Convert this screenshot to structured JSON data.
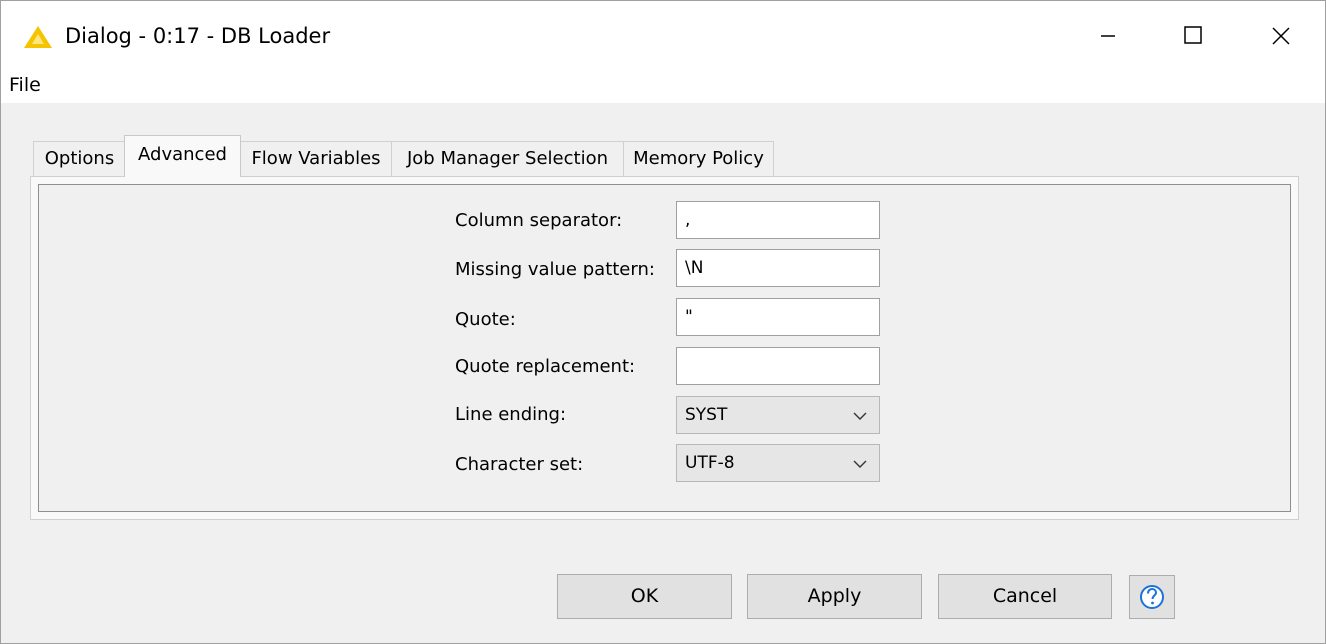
{
  "window": {
    "title": "Dialog - 0:17 - DB Loader",
    "accent_color": "#f5c400"
  },
  "menu": {
    "file_label": "File"
  },
  "tabs": [
    {
      "label": "Options",
      "active": false
    },
    {
      "label": "Advanced",
      "active": true
    },
    {
      "label": "Flow Variables",
      "active": false
    },
    {
      "label": "Job Manager Selection",
      "active": false
    },
    {
      "label": "Memory Policy",
      "active": false
    }
  ],
  "fields": {
    "column_separator": {
      "label": "Column separator:",
      "value": ","
    },
    "missing_value_pattern": {
      "label": "Missing value pattern:",
      "value": "\\N"
    },
    "quote": {
      "label": "Quote:",
      "value": "\""
    },
    "quote_replacement": {
      "label": "Quote replacement:",
      "value": ""
    },
    "line_ending": {
      "label": "Line ending:",
      "value": "SYST"
    },
    "character_set": {
      "label": "Character set:",
      "value": "UTF-8"
    }
  },
  "buttons": {
    "ok": "OK",
    "apply": "Apply",
    "cancel": "Cancel",
    "help_icon": "help-question-icon"
  }
}
